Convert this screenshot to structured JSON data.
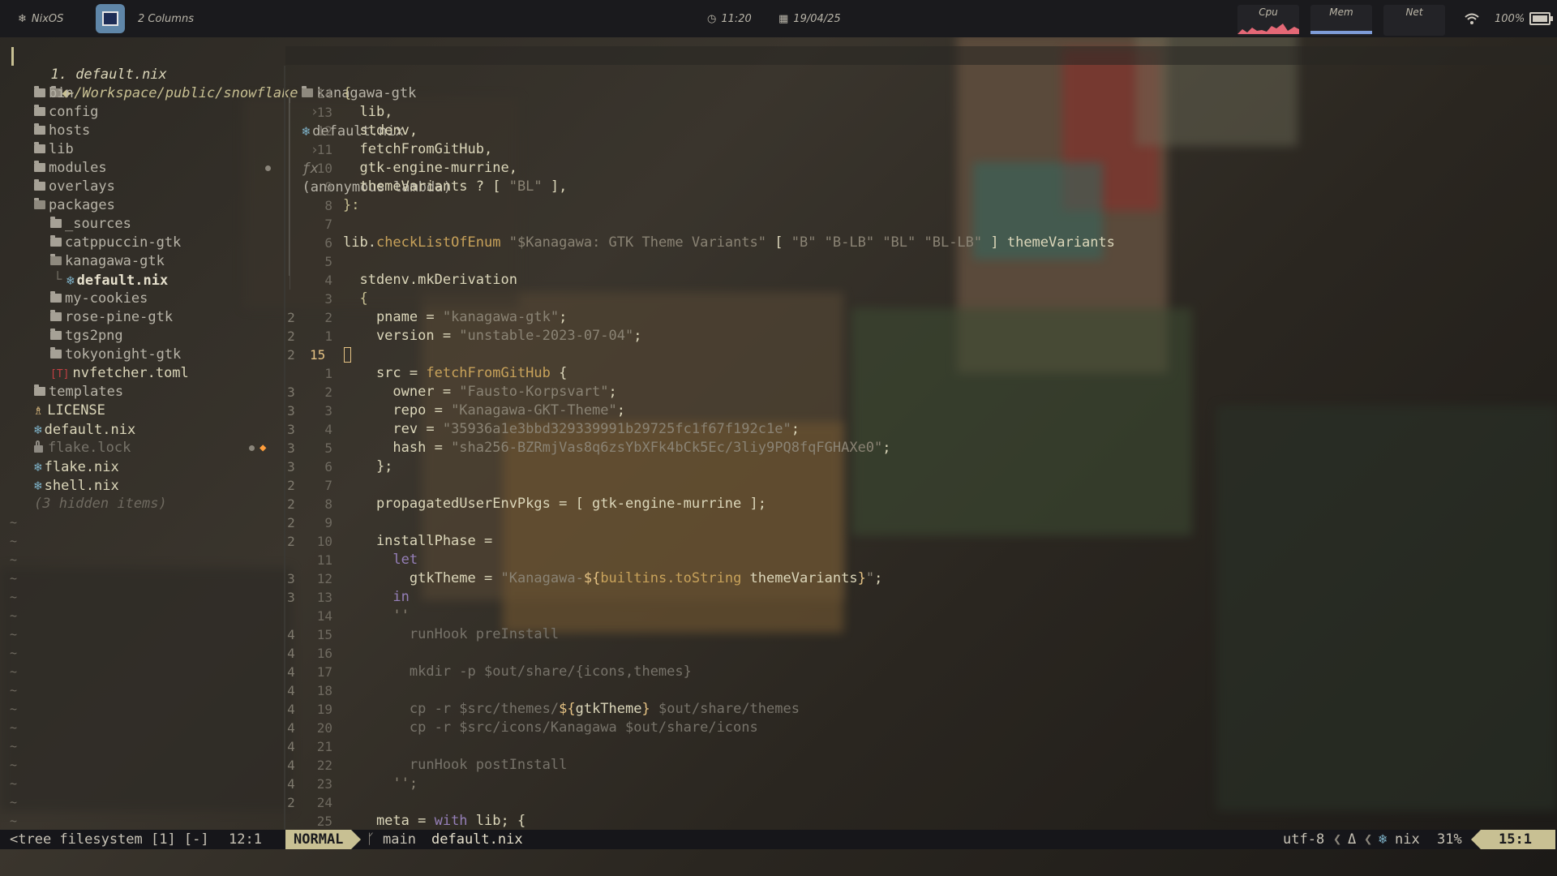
{
  "topbar": {
    "os_label": "NixOS",
    "layout_label": "2 Columns",
    "time": "11:20",
    "date": "19/04/25",
    "cpu_label": "Cpu",
    "mem_label": "Mem",
    "net_label": "Net",
    "battery": "100%"
  },
  "buffer_tab": {
    "label": "1. default.nix"
  },
  "tree": {
    "root": "~/Workspace/public/snowflake",
    "items": [
      "bin",
      "config",
      "hosts",
      "lib",
      "modules",
      "overlays",
      "packages",
      "_sources",
      "catppuccin-gtk",
      "kanagawa-gtk",
      "default.nix",
      "my-cookies",
      "rose-pine-gtk",
      "tgs2png",
      "tokyonight-gtk",
      "nvfetcher.toml",
      "templates",
      "LICENSE",
      "default.nix",
      "flake.lock",
      "flake.nix",
      "shell.nix"
    ],
    "hidden": "(3 hidden items)"
  },
  "breadcrumb": {
    "folder": "kanagawa-gtk",
    "file": "default.nix",
    "symbol": "(anonymous lambda)"
  },
  "editor": {
    "lines": [
      {
        "n": "14",
        "l": "",
        "c": [
          [
            "p",
            "{"
          ]
        ]
      },
      {
        "n": "13",
        "l": "",
        "c": [
          [
            "v",
            "  lib,"
          ]
        ]
      },
      {
        "n": "12",
        "l": "",
        "c": [
          [
            "v",
            "  stdenv,"
          ]
        ]
      },
      {
        "n": "11",
        "l": "",
        "c": [
          [
            "v",
            "  fetchFromGitHub,"
          ]
        ]
      },
      {
        "n": "10",
        "l": "",
        "c": [
          [
            "v",
            "  gtk-engine-murrine,"
          ]
        ]
      },
      {
        "n": "9",
        "l": "",
        "c": [
          [
            "v",
            "  themeVariants ? [ "
          ],
          [
            "s",
            "\"BL\""
          ],
          [
            "v",
            " ],"
          ]
        ]
      },
      {
        "n": "8",
        "l": "",
        "c": [
          [
            "p",
            "}:"
          ]
        ]
      },
      {
        "n": "7",
        "l": "",
        "c": []
      },
      {
        "n": "6",
        "l": "",
        "c": [
          [
            "v",
            "lib."
          ],
          [
            "f",
            "checkListOfEnum"
          ],
          [
            "v",
            " "
          ],
          [
            "s",
            "\"$Kanagawa: GTK Theme Variants\""
          ],
          [
            "v",
            " [ "
          ],
          [
            "s",
            "\"B\" \"B-LB\" \"BL\" \"BL-LB\""
          ],
          [
            "v",
            " ] themeVariants"
          ]
        ]
      },
      {
        "n": "5",
        "l": "",
        "c": []
      },
      {
        "n": "4",
        "l": "",
        "c": [
          [
            "v",
            "  stdenv.mkDerivation"
          ]
        ]
      },
      {
        "n": "3",
        "l": "",
        "c": [
          [
            "p",
            "  {"
          ]
        ]
      },
      {
        "n": "2",
        "l": "2",
        "c": [
          [
            "v",
            "    pname = "
          ],
          [
            "s",
            "\"kanagawa-gtk\""
          ],
          [
            "v",
            ";"
          ]
        ]
      },
      {
        "n": "1",
        "l": "2",
        "c": [
          [
            "v",
            "    version = "
          ],
          [
            "s",
            "\"unstable-2023-07-04\""
          ],
          [
            "v",
            ";"
          ]
        ]
      },
      {
        "n": "15",
        "l": "2",
        "cur": true,
        "c": []
      },
      {
        "n": "1",
        "l": "",
        "c": [
          [
            "v",
            "    src = "
          ],
          [
            "f",
            "fetchFromGitHub"
          ],
          [
            "v",
            " {"
          ]
        ]
      },
      {
        "n": "2",
        "l": "3",
        "c": [
          [
            "v",
            "      owner = "
          ],
          [
            "s",
            "\"Fausto-Korpsvart\""
          ],
          [
            "v",
            ";"
          ]
        ]
      },
      {
        "n": "3",
        "l": "3",
        "c": [
          [
            "v",
            "      repo = "
          ],
          [
            "s",
            "\"Kanagawa-GKT-Theme\""
          ],
          [
            "v",
            ";"
          ]
        ]
      },
      {
        "n": "4",
        "l": "3",
        "c": [
          [
            "v",
            "      rev = "
          ],
          [
            "s",
            "\"35936a1e3bbd329339991b29725fc1f67f192c1e\""
          ],
          [
            "v",
            ";"
          ]
        ]
      },
      {
        "n": "5",
        "l": "3",
        "c": [
          [
            "v",
            "      hash = "
          ],
          [
            "s",
            "\"sha256-BZRmjVas8q6zsYbXFk4bCk5Ec/3liy9PQ8fqFGHAXe0\""
          ],
          [
            "v",
            ";"
          ]
        ]
      },
      {
        "n": "6",
        "l": "3",
        "c": [
          [
            "v",
            "    };"
          ]
        ]
      },
      {
        "n": "7",
        "l": "2",
        "c": []
      },
      {
        "n": "8",
        "l": "2",
        "c": [
          [
            "v",
            "    propagatedUserEnvPkgs = [ gtk-engine-murrine ];"
          ]
        ]
      },
      {
        "n": "9",
        "l": "2",
        "c": []
      },
      {
        "n": "10",
        "l": "2",
        "c": [
          [
            "v",
            "    installPhase ="
          ]
        ]
      },
      {
        "n": "11",
        "l": "",
        "c": [
          [
            "k",
            "      let"
          ]
        ]
      },
      {
        "n": "12",
        "l": "3",
        "c": [
          [
            "v",
            "        gtkTheme = "
          ],
          [
            "s",
            "\"Kanagawa-"
          ],
          [
            "y",
            "${"
          ],
          [
            "f",
            "builtins.toString"
          ],
          [
            "v",
            " themeVariants"
          ],
          [
            "y",
            "}"
          ],
          [
            "s",
            "\""
          ],
          [
            "v",
            ";"
          ]
        ]
      },
      {
        "n": "13",
        "l": "3",
        "c": [
          [
            "k",
            "      in"
          ]
        ]
      },
      {
        "n": "14",
        "l": "",
        "c": [
          [
            "s",
            "      ''"
          ]
        ]
      },
      {
        "n": "15",
        "l": "4",
        "c": [
          [
            "dim",
            "        runHook preInstall"
          ]
        ]
      },
      {
        "n": "16",
        "l": "4",
        "c": []
      },
      {
        "n": "17",
        "l": "4",
        "c": [
          [
            "dim",
            "        mkdir -p $out/share/{icons,themes}"
          ]
        ]
      },
      {
        "n": "18",
        "l": "4",
        "c": []
      },
      {
        "n": "19",
        "l": "4",
        "c": [
          [
            "dim",
            "        cp -r $src/themes/"
          ],
          [
            "y",
            "${"
          ],
          [
            "v",
            "gtkTheme"
          ],
          [
            "y",
            "}"
          ],
          [
            "dim",
            " $out/share/themes"
          ]
        ]
      },
      {
        "n": "20",
        "l": "4",
        "c": [
          [
            "dim",
            "        cp -r $src/icons/Kanagawa $out/share/icons"
          ]
        ]
      },
      {
        "n": "21",
        "l": "4",
        "c": []
      },
      {
        "n": "22",
        "l": "4",
        "c": [
          [
            "dim",
            "        runHook postInstall"
          ]
        ]
      },
      {
        "n": "23",
        "l": "4",
        "c": [
          [
            "s",
            "      '';"
          ]
        ]
      },
      {
        "n": "24",
        "l": "2",
        "c": []
      },
      {
        "n": "25",
        "l": "",
        "c": [
          [
            "v",
            "    meta = "
          ],
          [
            "k",
            "with"
          ],
          [
            "v",
            " lib; {"
          ]
        ]
      }
    ]
  },
  "status": {
    "left": "<tree filesystem [1] [-]",
    "left_pos": "12:1",
    "mode": "NORMAL",
    "branch": "main",
    "file": "default.nix",
    "encoding": "utf-8",
    "filetype": "nix",
    "percent": "31%",
    "position": "15:1"
  },
  "colors": {
    "accent": "#c8c093",
    "string": "#8a8374",
    "keyword": "#957fb8",
    "function": "#c8a25a",
    "icon_blue": "#7fb4ca",
    "warning": "#ff9e3b"
  }
}
